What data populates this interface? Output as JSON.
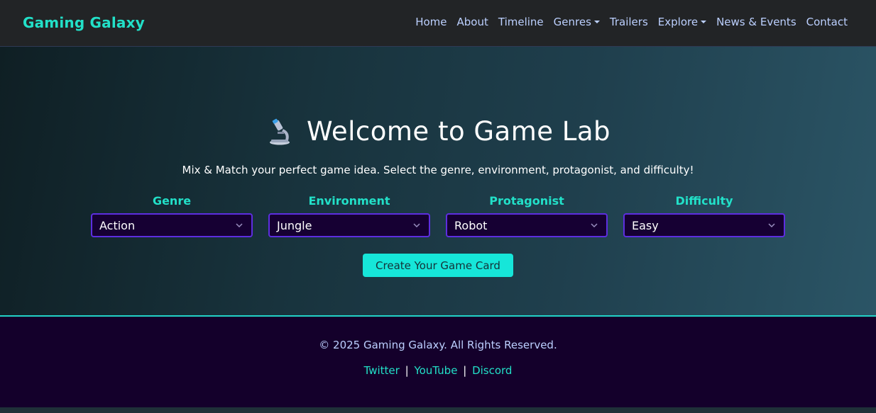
{
  "navbar": {
    "brand": "Gaming Galaxy",
    "links": [
      {
        "label": "Home"
      },
      {
        "label": "About"
      },
      {
        "label": "Timeline"
      },
      {
        "label": "Genres",
        "dropdown": true
      },
      {
        "label": "Trailers"
      },
      {
        "label": "Explore",
        "dropdown": true
      },
      {
        "label": "News & Events"
      },
      {
        "label": "Contact"
      }
    ]
  },
  "hero": {
    "icon": "microscope-icon",
    "title": "Welcome to Game Lab",
    "subtitle": "Mix & Match your perfect game idea. Select the genre, environment, protagonist, and difficulty!",
    "selectors": [
      {
        "label": "Genre",
        "value": "Action"
      },
      {
        "label": "Environment",
        "value": "Jungle"
      },
      {
        "label": "Protagonist",
        "value": "Robot"
      },
      {
        "label": "Difficulty",
        "value": "Easy"
      }
    ],
    "button_label": "Create Your Game Card"
  },
  "footer": {
    "copyright": "© 2025 Gaming Galaxy. All Rights Reserved.",
    "social": [
      {
        "label": "Twitter"
      },
      {
        "label": "YouTube"
      },
      {
        "label": "Discord"
      }
    ],
    "separator": "|"
  },
  "colors": {
    "accent": "#22e0c8",
    "nav_text": "#bcd0ff",
    "button_bg": "#16e6d9",
    "select_border": "#5d2ee0",
    "select_bg": "#160033",
    "footer_bg": "#14002b"
  }
}
